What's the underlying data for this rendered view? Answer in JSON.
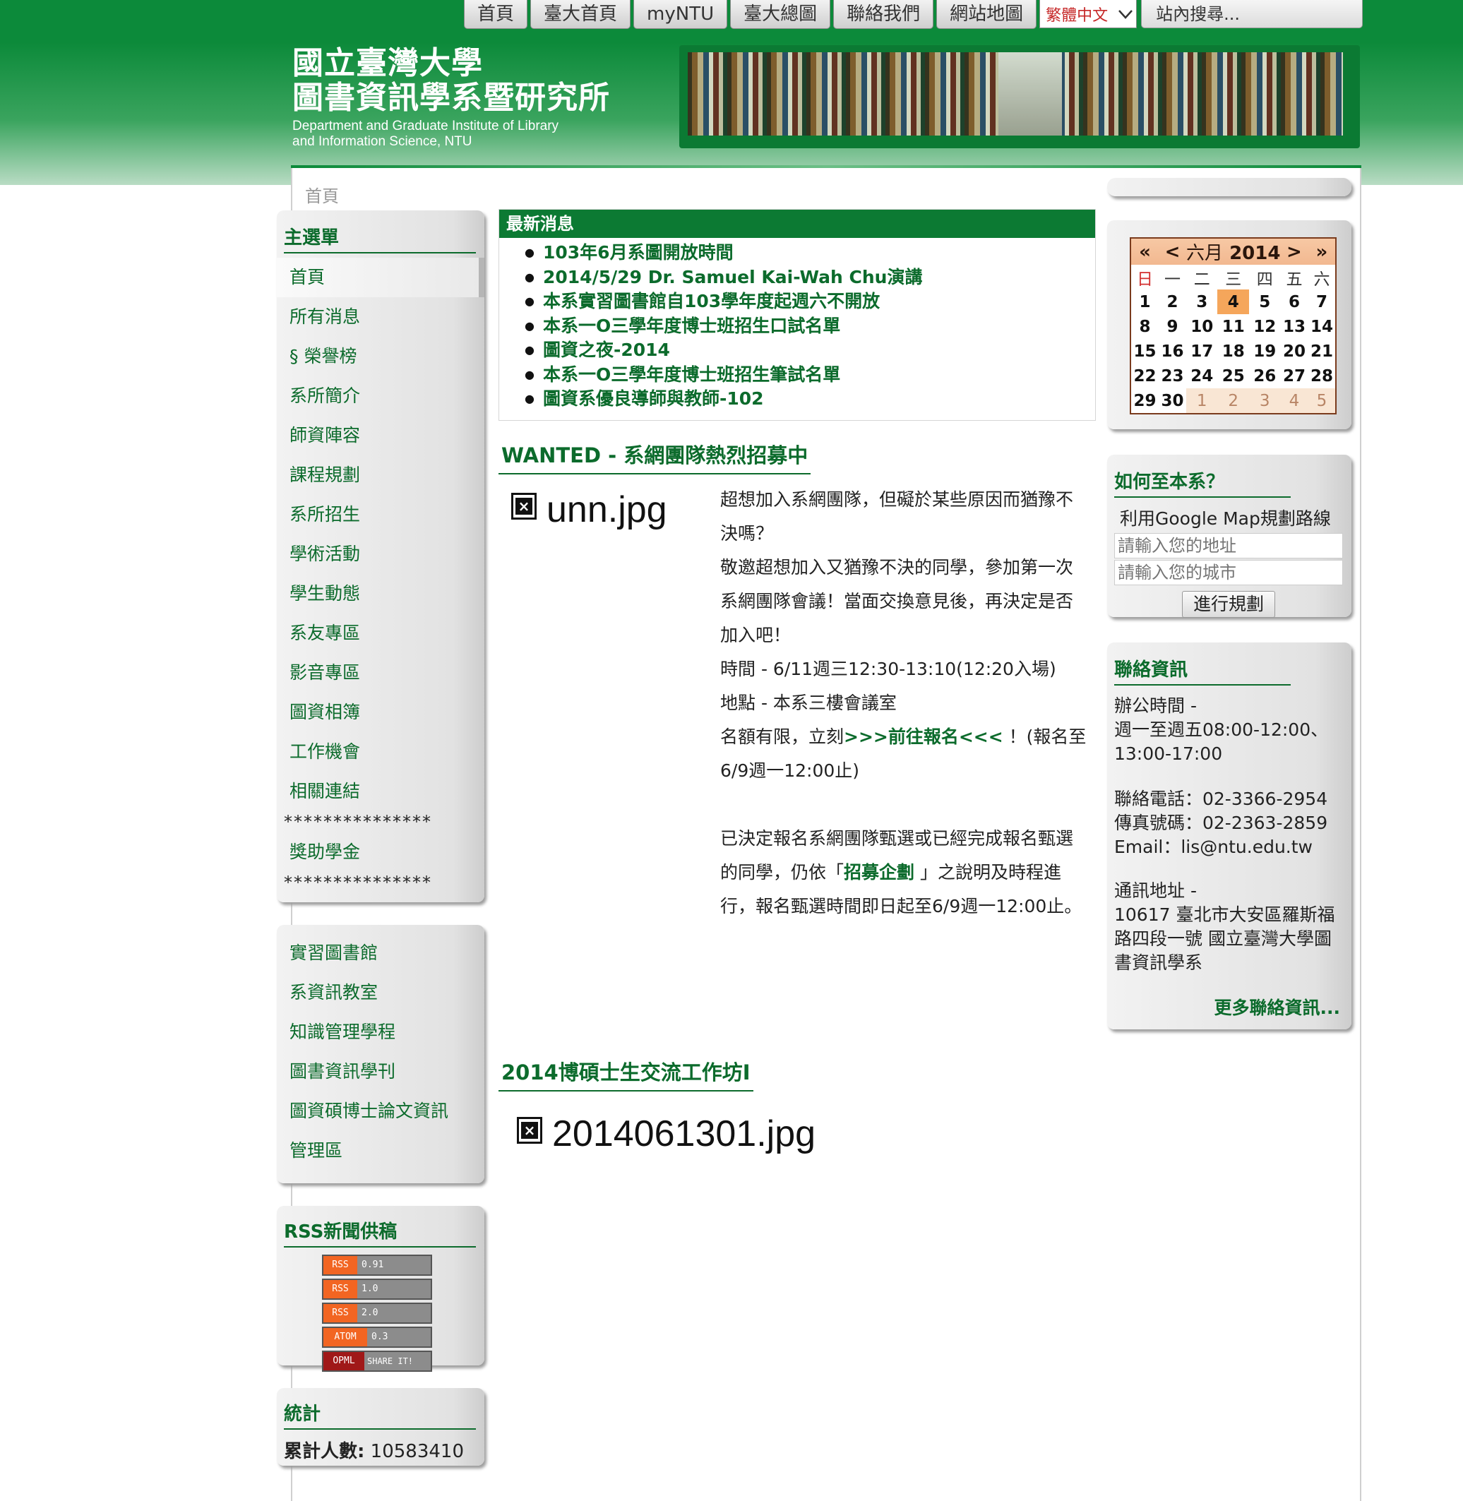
{
  "top_nav": {
    "items": [
      "首頁",
      "臺大首頁",
      "myNTU",
      "臺大總圖",
      "聯絡我們",
      "網站地圖"
    ],
    "language": "繁體中文",
    "search_placeholder": "站內搜尋..."
  },
  "header": {
    "title_line1": "國立臺灣大學",
    "title_line2": "圖書資訊學系暨研究所",
    "title_en_line1": "Department and Graduate Institute of Library",
    "title_en_line2": "and Information Science, NTU"
  },
  "breadcrumb": "首頁",
  "main_menu": {
    "title": "主選單",
    "items": [
      "首頁",
      "所有消息",
      "§ 榮譽榜",
      "系所簡介",
      "師資陣容",
      "課程規劃",
      "系所招生",
      "學術活動",
      "學生動態",
      "系友專區",
      "影音專區",
      "圖資相簿",
      "工作機會",
      "相關連結"
    ],
    "stars": "***************",
    "extra_item": "獎助學金"
  },
  "links_menu": {
    "items": [
      "實習圖書館",
      "系資訊教室",
      "知識管理學程",
      "圖書資訊學刊",
      "圖資碩博士論文資訊",
      "管理區"
    ]
  },
  "rss": {
    "title": "RSS新聞供稿",
    "badges": [
      {
        "left": "RSS",
        "right": "0.91"
      },
      {
        "left": "RSS",
        "right": "1.0"
      },
      {
        "left": "RSS",
        "right": "2.0"
      },
      {
        "left": "ATOM",
        "right": "0.3"
      },
      {
        "left": "OPML",
        "right": "SHARE IT!"
      }
    ]
  },
  "stats": {
    "title": "統計",
    "label": "累計人數:",
    "value": "10583410"
  },
  "news": {
    "title": "最新消息",
    "items": [
      "103年6月系圖開放時間",
      "2014/5/29 Dr. Samuel Kai-Wah Chu演講",
      "本系實習圖書館自103學年度起週六不開放",
      "本系一О三學年度博士班招生口試名單",
      "圖資之夜-2014",
      "本系一О三學年度博士班招生筆試名單",
      "圖資系優良導師與教師-102"
    ]
  },
  "article1": {
    "title": "WANTED - 系網團隊熱烈招募中",
    "image_alt": "unn.jpg",
    "lines": [
      "超想加入系網團隊，但礙於某些原因而猶豫不決嗎？",
      "敬邀超想加入又猶豫不決的同學，參加第一次系網團隊會議！當面交換意見後，再決定是否加入吧！",
      "時間 - 6/11週三12:30-13:10(12:20入場)",
      "地點 - 本系三樓會議室"
    ],
    "signup_prefix": "名額有限，立刻",
    "signup_link": ">>>前往報名<<<",
    "signup_suffix": " ！(報名至6/9週一12:00止)",
    "para2_prefix": "已決定報名系網團隊甄選或已經完成報名甄選的同學，仍依「",
    "para2_link": "招募企劃",
    "para2_suffix": " 」之說明及時程進行，報名甄選時間即日起至6/9週一12:00止。"
  },
  "article2": {
    "title": "2014博碩士生交流工作坊I",
    "image_alt": "2014061301.jpg"
  },
  "calendar": {
    "nav_prev_year": "«",
    "nav_prev": "<",
    "month": "六月",
    "year": "2014",
    "nav_next": ">",
    "nav_next_year": "»",
    "weekdays": [
      "日",
      "一",
      "二",
      "三",
      "四",
      "五",
      "六"
    ],
    "weeks": [
      [
        "1",
        "2",
        "3",
        "4",
        "5",
        "6",
        "7"
      ],
      [
        "8",
        "9",
        "10",
        "11",
        "12",
        "13",
        "14"
      ],
      [
        "15",
        "16",
        "17",
        "18",
        "19",
        "20",
        "21"
      ],
      [
        "22",
        "23",
        "24",
        "25",
        "26",
        "27",
        "28"
      ],
      [
        "29",
        "30",
        "1",
        "2",
        "3",
        "4",
        "5"
      ]
    ],
    "today": "4"
  },
  "directions": {
    "title": "如何至本系？",
    "subtitle": "利用Google Map規劃路線",
    "address_placeholder": "請輸入您的地址",
    "city_placeholder": "請輸入您的城市",
    "button": "進行規劃"
  },
  "contact": {
    "title": "聯絡資訊",
    "hours_label": "辦公時間 -",
    "hours_value": "週一至週五08:00-12:00、13:00-17:00",
    "phone": "聯絡電話：02-3366-2954",
    "fax": "傳真號碼：02-2363-2859",
    "email": "Email：lis@ntu.edu.tw",
    "address_label": "通訊地址 -",
    "address_value": "10617 臺北市大安區羅斯福路四段一號 國立臺灣大學圖書資訊學系",
    "more": "更多聯絡資訊..."
  },
  "colors": {
    "brand_green": "#0c8a3a",
    "link_green": "#0c6b2c",
    "today_highlight": "#f5a65b"
  }
}
